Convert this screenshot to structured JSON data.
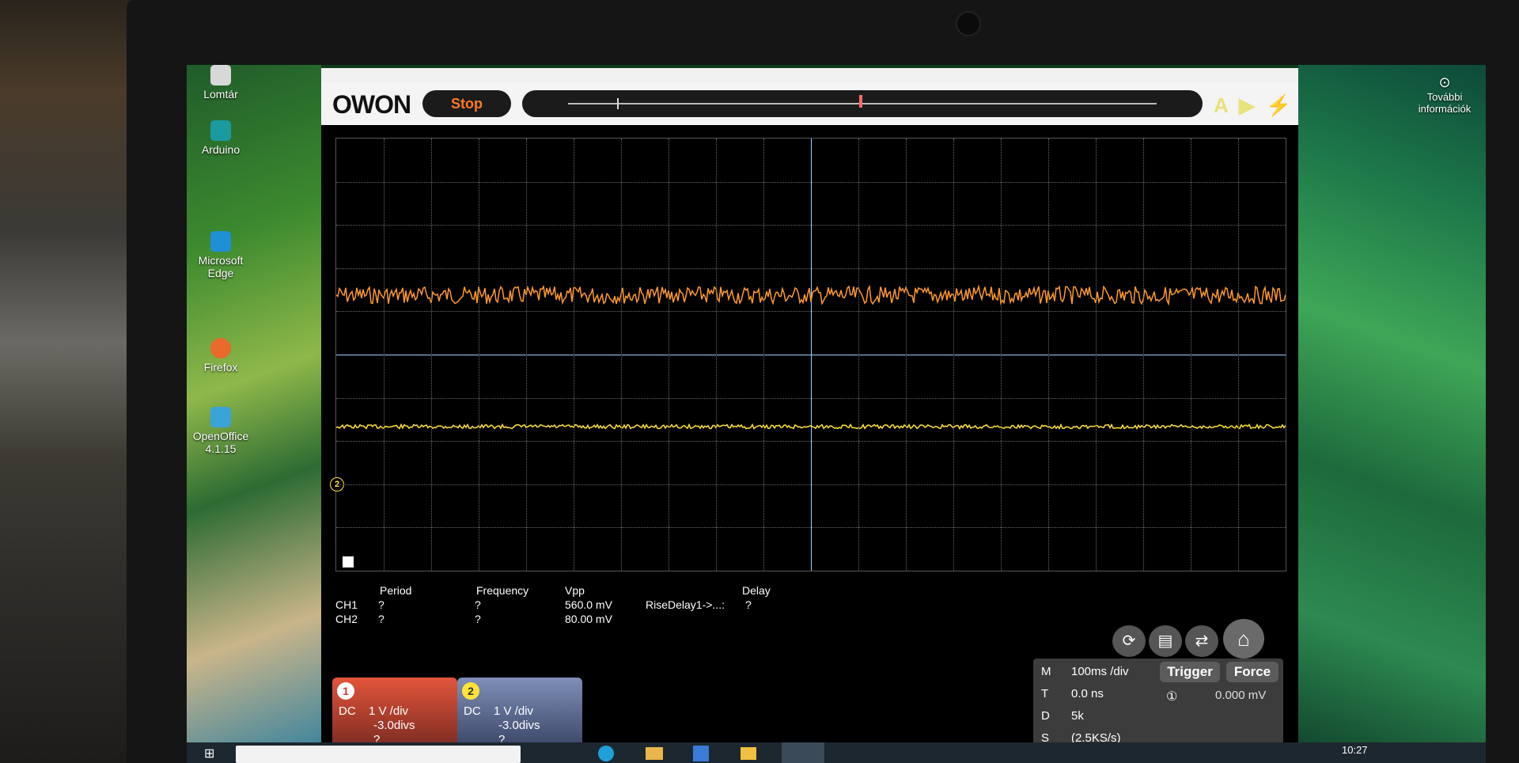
{
  "desktop": {
    "icons": [
      {
        "label": "Lomtár"
      },
      {
        "label": "Arduino"
      },
      {
        "label": "Microsoft Edge"
      },
      {
        "label": "Firefox"
      },
      {
        "label": "OpenOffice 4.1.15"
      }
    ],
    "right_info": "További információk"
  },
  "app": {
    "logo": "OWON",
    "stop_label": "Stop",
    "toolbar_icons": [
      "auto-icon",
      "play-icon",
      "flash-icon"
    ]
  },
  "scope": {
    "ch1_color": "#ff9a2e",
    "ch2_color": "#ffe23a",
    "ch2_marker": "2"
  },
  "measurements": {
    "headers": {
      "period": "Period",
      "frequency": "Frequency",
      "vpp": "Vpp",
      "delay": "Delay"
    },
    "rows": [
      {
        "channel": "CH1",
        "period": "?",
        "frequency": "?",
        "vpp": "560.0 mV",
        "delay_name": "RiseDelay1->...:",
        "delay": "?"
      },
      {
        "channel": "CH2",
        "period": "?",
        "frequency": "?",
        "vpp": "80.00 mV",
        "delay_name": "",
        "delay": ""
      }
    ]
  },
  "channels": [
    {
      "number": "1",
      "coupling": "DC",
      "scale": "1 V /div",
      "offset": "-3.0divs",
      "extra": "?",
      "color": "#e2553a"
    },
    {
      "number": "2",
      "coupling": "DC",
      "scale": "1 V /div",
      "offset": "-3.0divs",
      "extra": "?",
      "color": "#5a6fa0"
    }
  ],
  "timebase": {
    "m_label": "M",
    "m_value": "100ms /div",
    "t_label": "T",
    "t_value": "0.0 ns",
    "d_label": "D",
    "d_value": "5k",
    "s_label": "S",
    "s_value": "(2.5KS/s)"
  },
  "trigger": {
    "trigger_label": "Trigger",
    "force_label": "Force",
    "source": "①",
    "level": "0.000 mV"
  },
  "control_icons": [
    "refresh-icon",
    "save-icon",
    "swap-icon",
    "home-icon"
  ],
  "taskbar": {
    "clock": "10:27"
  }
}
